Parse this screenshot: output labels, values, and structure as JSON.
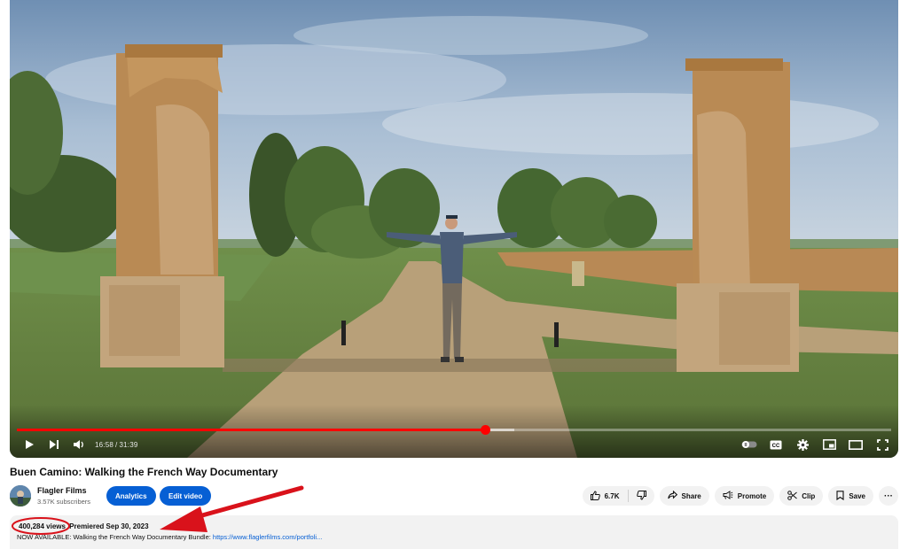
{
  "player": {
    "current_time": "16:58",
    "separator": "/",
    "duration": "31:39",
    "progress_fraction": 0.536,
    "buffered_fraction": 0.569
  },
  "video": {
    "title": "Buen Camino: Walking the French Way Documentary"
  },
  "channel": {
    "name": "Flagler Films",
    "subscribers": "3.57K subscribers"
  },
  "buttons": {
    "analytics": "Analytics",
    "edit_video": "Edit video",
    "like_count": "6.7K",
    "share": "Share",
    "promote": "Promote",
    "clip": "Clip",
    "save": "Save",
    "more": "···"
  },
  "description": {
    "views": "400,284 views",
    "premiered": "Premiered Sep 30, 2023",
    "text": "NOW AVAILABLE: Walking the French Way Documentary Bundle: ",
    "link": "https://www.flaglerfilms.com/portfoli..."
  },
  "colors": {
    "accent_blue": "#065fd4",
    "progress_red": "#ff0000",
    "annotation_red": "#d9121b"
  },
  "icons": [
    "play-icon",
    "next-icon",
    "volume-icon",
    "autoplay-toggle-icon",
    "captions-icon",
    "settings-gear-icon",
    "miniplayer-icon",
    "theater-mode-icon",
    "fullscreen-icon",
    "thumbs-up-icon",
    "thumbs-down-icon",
    "share-icon",
    "promote-icon",
    "scissors-icon",
    "bookmark-icon"
  ]
}
